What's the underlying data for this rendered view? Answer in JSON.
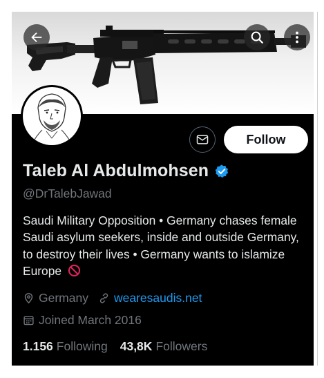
{
  "header": {
    "back_icon": "arrow-left-icon",
    "search_icon": "search-icon",
    "more_icon": "more-vertical-icon"
  },
  "banner": {
    "image": "black rifle on light background"
  },
  "profile": {
    "display_name": "Taleb Al Abdulmohsen",
    "verified_badge": "verified-badge-icon",
    "handle": "@DrTalebJawad",
    "bio": "Saudi Military Opposition • Germany chases female Saudi asylum seekers, inside and outside Germany, to destroy their lives • Germany wants to islamize Europe",
    "bio_emoji": "🚫",
    "location": "Germany",
    "website": "wearesaudis.net",
    "joined": "Joined March 2016"
  },
  "actions": {
    "message_icon": "envelope-icon",
    "follow_label": "Follow"
  },
  "stats": {
    "following_count": "1.156",
    "following_label": "Following",
    "followers_count": "43,8K",
    "followers_label": "Followers"
  },
  "colors": {
    "background": "#000000",
    "text_primary": "#e7e9ea",
    "text_secondary": "#71767b",
    "link": "#1d9bf0",
    "verified": "#1d9bf0",
    "no_entry": "#e0245e"
  }
}
